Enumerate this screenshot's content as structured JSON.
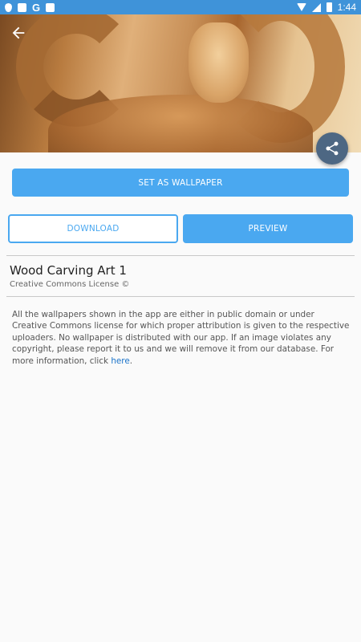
{
  "status_bar": {
    "time": "1:44",
    "icons": [
      "shield-icon",
      "image-icon",
      "google-icon",
      "text-icon",
      "wifi-icon",
      "signal-icon",
      "battery-icon"
    ],
    "google_letter": "G"
  },
  "hero": {
    "description_icon": "back-arrow-icon"
  },
  "actions": {
    "set_wallpaper": "SET AS WALLPAPER",
    "download": "DOWNLOAD",
    "preview": "PREVIEW",
    "share_icon": "share-icon"
  },
  "wallpaper": {
    "title": "Wood Carving Art 1",
    "license": "Creative Commons License ©"
  },
  "disclaimer": {
    "text": "All the wallpapers shown in the app are either in public domain or under Creative Commons license for which proper attribution is given to the respective uploaders. No wallpaper is distributed with our app. If an image violates any copyright, please report it to us and we will remove it from our database. For more information, click ",
    "link": "here",
    "end": "."
  },
  "colors": {
    "accent": "#4aa8f0",
    "status_bar": "#3f93d9",
    "fab": "#4d6783"
  }
}
